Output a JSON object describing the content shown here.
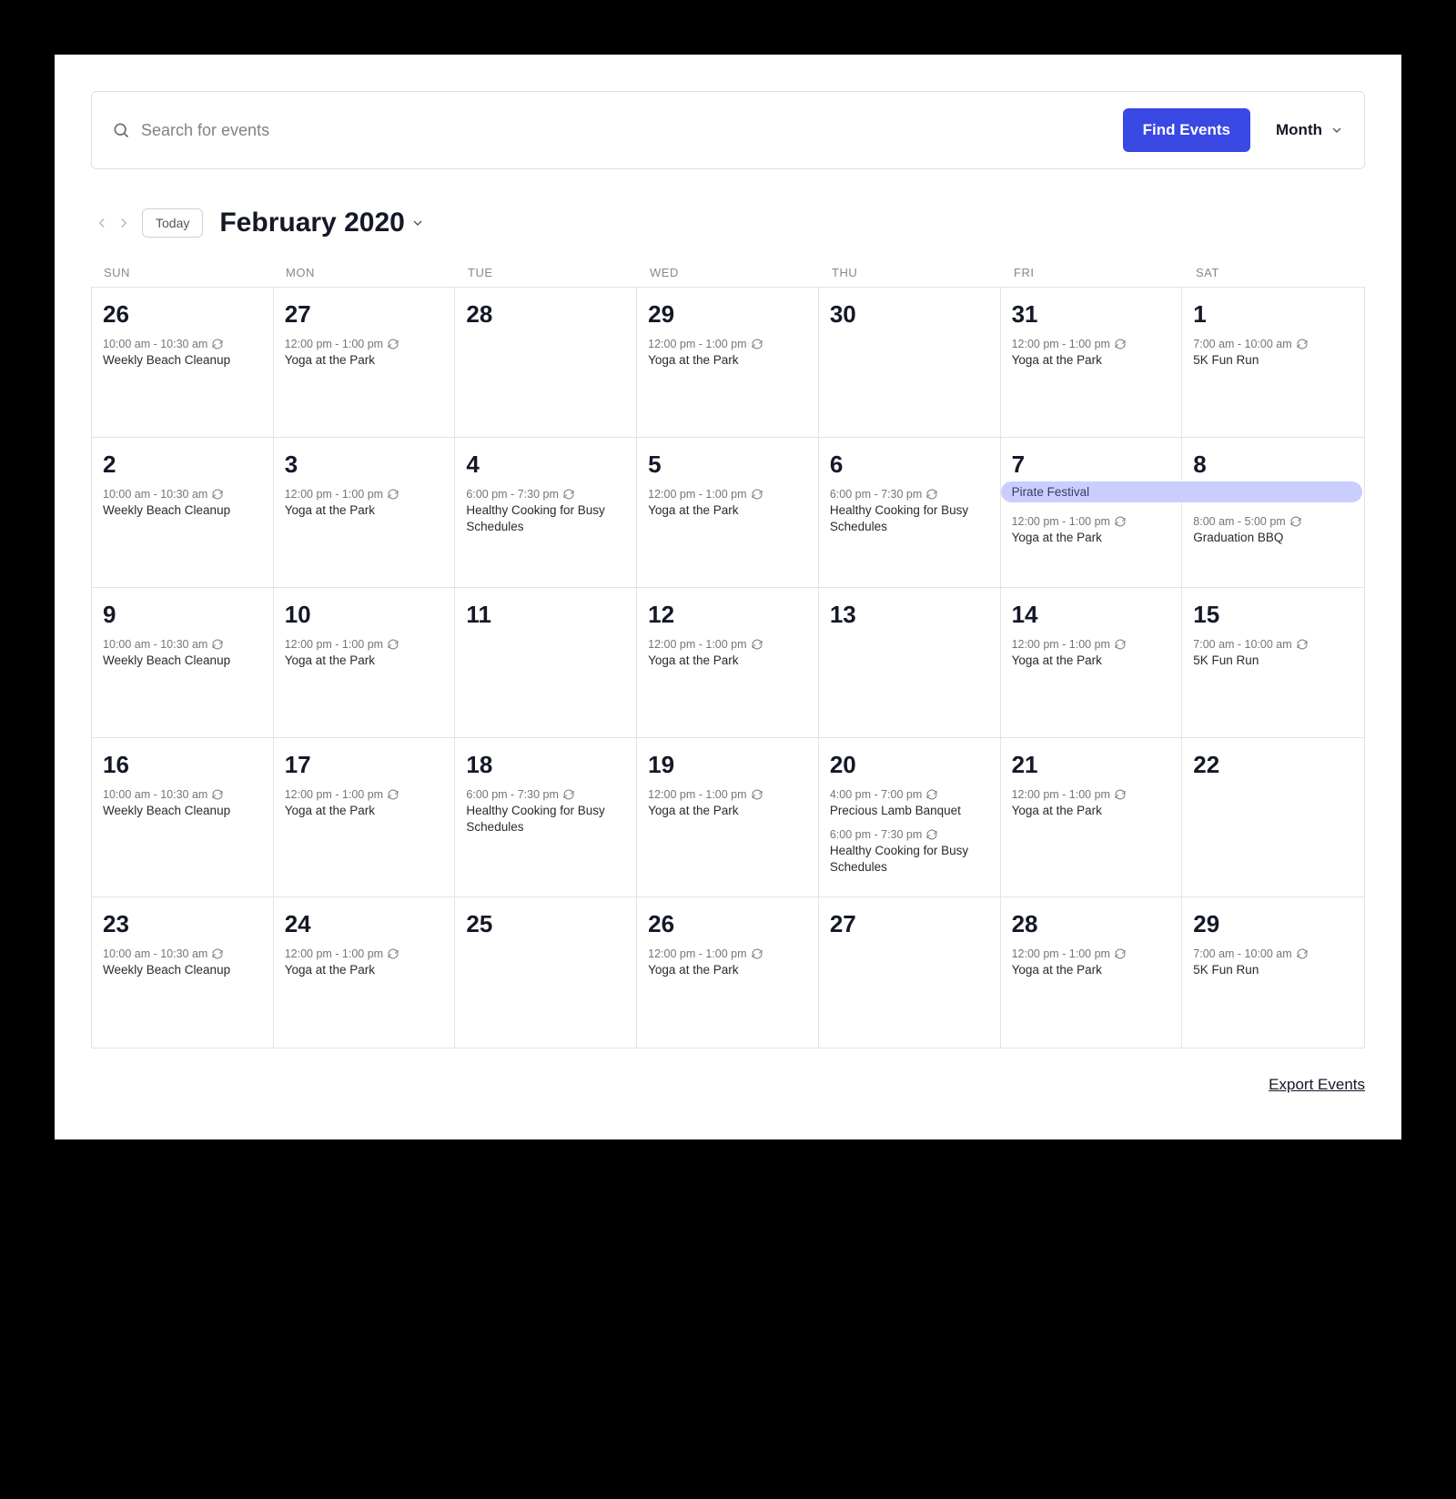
{
  "search": {
    "placeholder": "Search for events"
  },
  "find_button": "Find Events",
  "view_label": "Month",
  "today_button": "Today",
  "month_title": "February 2020",
  "export_link": "Export Events",
  "day_headers": [
    "SUN",
    "MON",
    "TUE",
    "WED",
    "THU",
    "FRI",
    "SAT"
  ],
  "weeks": [
    [
      {
        "num": "26",
        "events": [
          {
            "time": "10:00 am - 10:30 am",
            "recurring": true,
            "title": "Weekly Beach Cleanup"
          }
        ]
      },
      {
        "num": "27",
        "events": [
          {
            "time": "12:00 pm - 1:00 pm",
            "recurring": true,
            "title": "Yoga at the Park"
          }
        ]
      },
      {
        "num": "28",
        "events": []
      },
      {
        "num": "29",
        "events": [
          {
            "time": "12:00 pm - 1:00 pm",
            "recurring": true,
            "title": "Yoga at the Park"
          }
        ]
      },
      {
        "num": "30",
        "events": []
      },
      {
        "num": "31",
        "events": [
          {
            "time": "12:00 pm - 1:00 pm",
            "recurring": true,
            "title": "Yoga at the Park"
          }
        ]
      },
      {
        "num": "1",
        "events": [
          {
            "time": "7:00 am - 10:00 am",
            "recurring": true,
            "title": "5K Fun Run"
          }
        ]
      }
    ],
    [
      {
        "num": "2",
        "events": [
          {
            "time": "10:00 am - 10:30 am",
            "recurring": true,
            "title": "Weekly Beach Cleanup"
          }
        ]
      },
      {
        "num": "3",
        "events": [
          {
            "time": "12:00 pm - 1:00 pm",
            "recurring": true,
            "title": "Yoga at the Park"
          }
        ]
      },
      {
        "num": "4",
        "events": [
          {
            "time": "6:00 pm - 7:30 pm",
            "recurring": true,
            "title": "Healthy Cooking for Busy Schedules"
          }
        ]
      },
      {
        "num": "5",
        "events": [
          {
            "time": "12:00 pm - 1:00 pm",
            "recurring": true,
            "title": "Yoga at the Park"
          }
        ]
      },
      {
        "num": "6",
        "events": [
          {
            "time": "6:00 pm - 7:30 pm",
            "recurring": true,
            "title": "Healthy Cooking for Busy Schedules"
          }
        ]
      },
      {
        "num": "7",
        "multiday_start": "Pirate Festival",
        "push": true,
        "events": [
          {
            "time": "12:00 pm - 1:00 pm",
            "recurring": true,
            "title": "Yoga at the Park"
          }
        ]
      },
      {
        "num": "8",
        "push": true,
        "events": [
          {
            "time": "8:00 am - 5:00 pm",
            "recurring": true,
            "title": "Graduation BBQ"
          }
        ]
      }
    ],
    [
      {
        "num": "9",
        "events": [
          {
            "time": "10:00 am - 10:30 am",
            "recurring": true,
            "title": "Weekly Beach Cleanup"
          }
        ]
      },
      {
        "num": "10",
        "events": [
          {
            "time": "12:00 pm - 1:00 pm",
            "recurring": true,
            "title": "Yoga at the Park"
          }
        ]
      },
      {
        "num": "11",
        "events": []
      },
      {
        "num": "12",
        "events": [
          {
            "time": "12:00 pm - 1:00 pm",
            "recurring": true,
            "title": "Yoga at the Park"
          }
        ]
      },
      {
        "num": "13",
        "events": []
      },
      {
        "num": "14",
        "events": [
          {
            "time": "12:00 pm - 1:00 pm",
            "recurring": true,
            "title": "Yoga at the Park"
          }
        ]
      },
      {
        "num": "15",
        "events": [
          {
            "time": "7:00 am - 10:00 am",
            "recurring": true,
            "title": "5K Fun Run"
          }
        ]
      }
    ],
    [
      {
        "num": "16",
        "events": [
          {
            "time": "10:00 am - 10:30 am",
            "recurring": true,
            "title": "Weekly Beach Cleanup"
          }
        ]
      },
      {
        "num": "17",
        "events": [
          {
            "time": "12:00 pm - 1:00 pm",
            "recurring": true,
            "title": "Yoga at the Park"
          }
        ]
      },
      {
        "num": "18",
        "events": [
          {
            "time": "6:00 pm - 7:30 pm",
            "recurring": true,
            "title": "Healthy Cooking for Busy Schedules"
          }
        ]
      },
      {
        "num": "19",
        "events": [
          {
            "time": "12:00 pm - 1:00 pm",
            "recurring": true,
            "title": "Yoga at the Park"
          }
        ]
      },
      {
        "num": "20",
        "events": [
          {
            "time": "4:00 pm - 7:00 pm",
            "recurring": true,
            "title": "Precious Lamb Banquet"
          },
          {
            "time": "6:00 pm - 7:30 pm",
            "recurring": true,
            "title": "Healthy Cooking for Busy Schedules"
          }
        ]
      },
      {
        "num": "21",
        "events": [
          {
            "time": "12:00 pm - 1:00 pm",
            "recurring": true,
            "title": "Yoga at the Park"
          }
        ]
      },
      {
        "num": "22",
        "events": []
      }
    ],
    [
      {
        "num": "23",
        "events": [
          {
            "time": "10:00 am - 10:30 am",
            "recurring": true,
            "title": "Weekly Beach Cleanup"
          }
        ]
      },
      {
        "num": "24",
        "events": [
          {
            "time": "12:00 pm - 1:00 pm",
            "recurring": true,
            "title": "Yoga at the Park"
          }
        ]
      },
      {
        "num": "25",
        "events": []
      },
      {
        "num": "26",
        "events": [
          {
            "time": "12:00 pm - 1:00 pm",
            "recurring": true,
            "title": "Yoga at the Park"
          }
        ]
      },
      {
        "num": "27",
        "events": []
      },
      {
        "num": "28",
        "events": [
          {
            "time": "12:00 pm - 1:00 pm",
            "recurring": true,
            "title": "Yoga at the Park"
          }
        ]
      },
      {
        "num": "29",
        "events": [
          {
            "time": "7:00 am - 10:00 am",
            "recurring": true,
            "title": "5K Fun Run"
          }
        ]
      }
    ]
  ]
}
